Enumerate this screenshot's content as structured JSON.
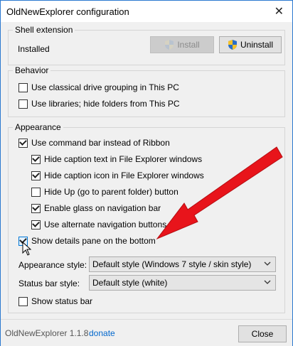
{
  "window": {
    "title": "OldNewExplorer configuration",
    "close_glyph": "✕"
  },
  "shell": {
    "group_title": "Shell extension",
    "status": "Installed",
    "install_label": "Install",
    "uninstall_label": "Uninstall"
  },
  "behavior": {
    "group_title": "Behavior",
    "options": [
      {
        "label": "Use classical drive grouping in This PC",
        "checked": false
      },
      {
        "label": "Use libraries; hide folders from This PC",
        "checked": false
      }
    ]
  },
  "appearance": {
    "group_title": "Appearance",
    "options": [
      {
        "label": "Use command bar instead of Ribbon",
        "checked": true
      },
      {
        "label": "Hide caption text in File Explorer windows",
        "checked": true
      },
      {
        "label": "Hide caption icon in File Explorer windows",
        "checked": true
      },
      {
        "label": "Hide Up (go to parent folder) button",
        "checked": false
      },
      {
        "label": "Enable glass on navigation bar",
        "checked": true
      },
      {
        "label": "Use alternate navigation buttons",
        "checked": true
      },
      {
        "label": "Show details pane on the bottom",
        "checked": true
      }
    ],
    "appearance_style_label": "Appearance style:",
    "appearance_style_value": "Default style (Windows 7 style / skin style)",
    "status_bar_style_label": "Status bar style:",
    "status_bar_style_value": "Default style (white)",
    "show_status_bar_label": "Show status bar",
    "show_status_bar_checked": false
  },
  "footer": {
    "version": "OldNewExplorer 1.1.8",
    "donate_label": "donate",
    "close_label": "Close"
  },
  "colors": {
    "arrow": "#e8141b",
    "title_border": "#2b79d0",
    "link": "#0066cc",
    "shield_blue": "#2a6fc7",
    "shield_yellow": "#f5c22a"
  }
}
